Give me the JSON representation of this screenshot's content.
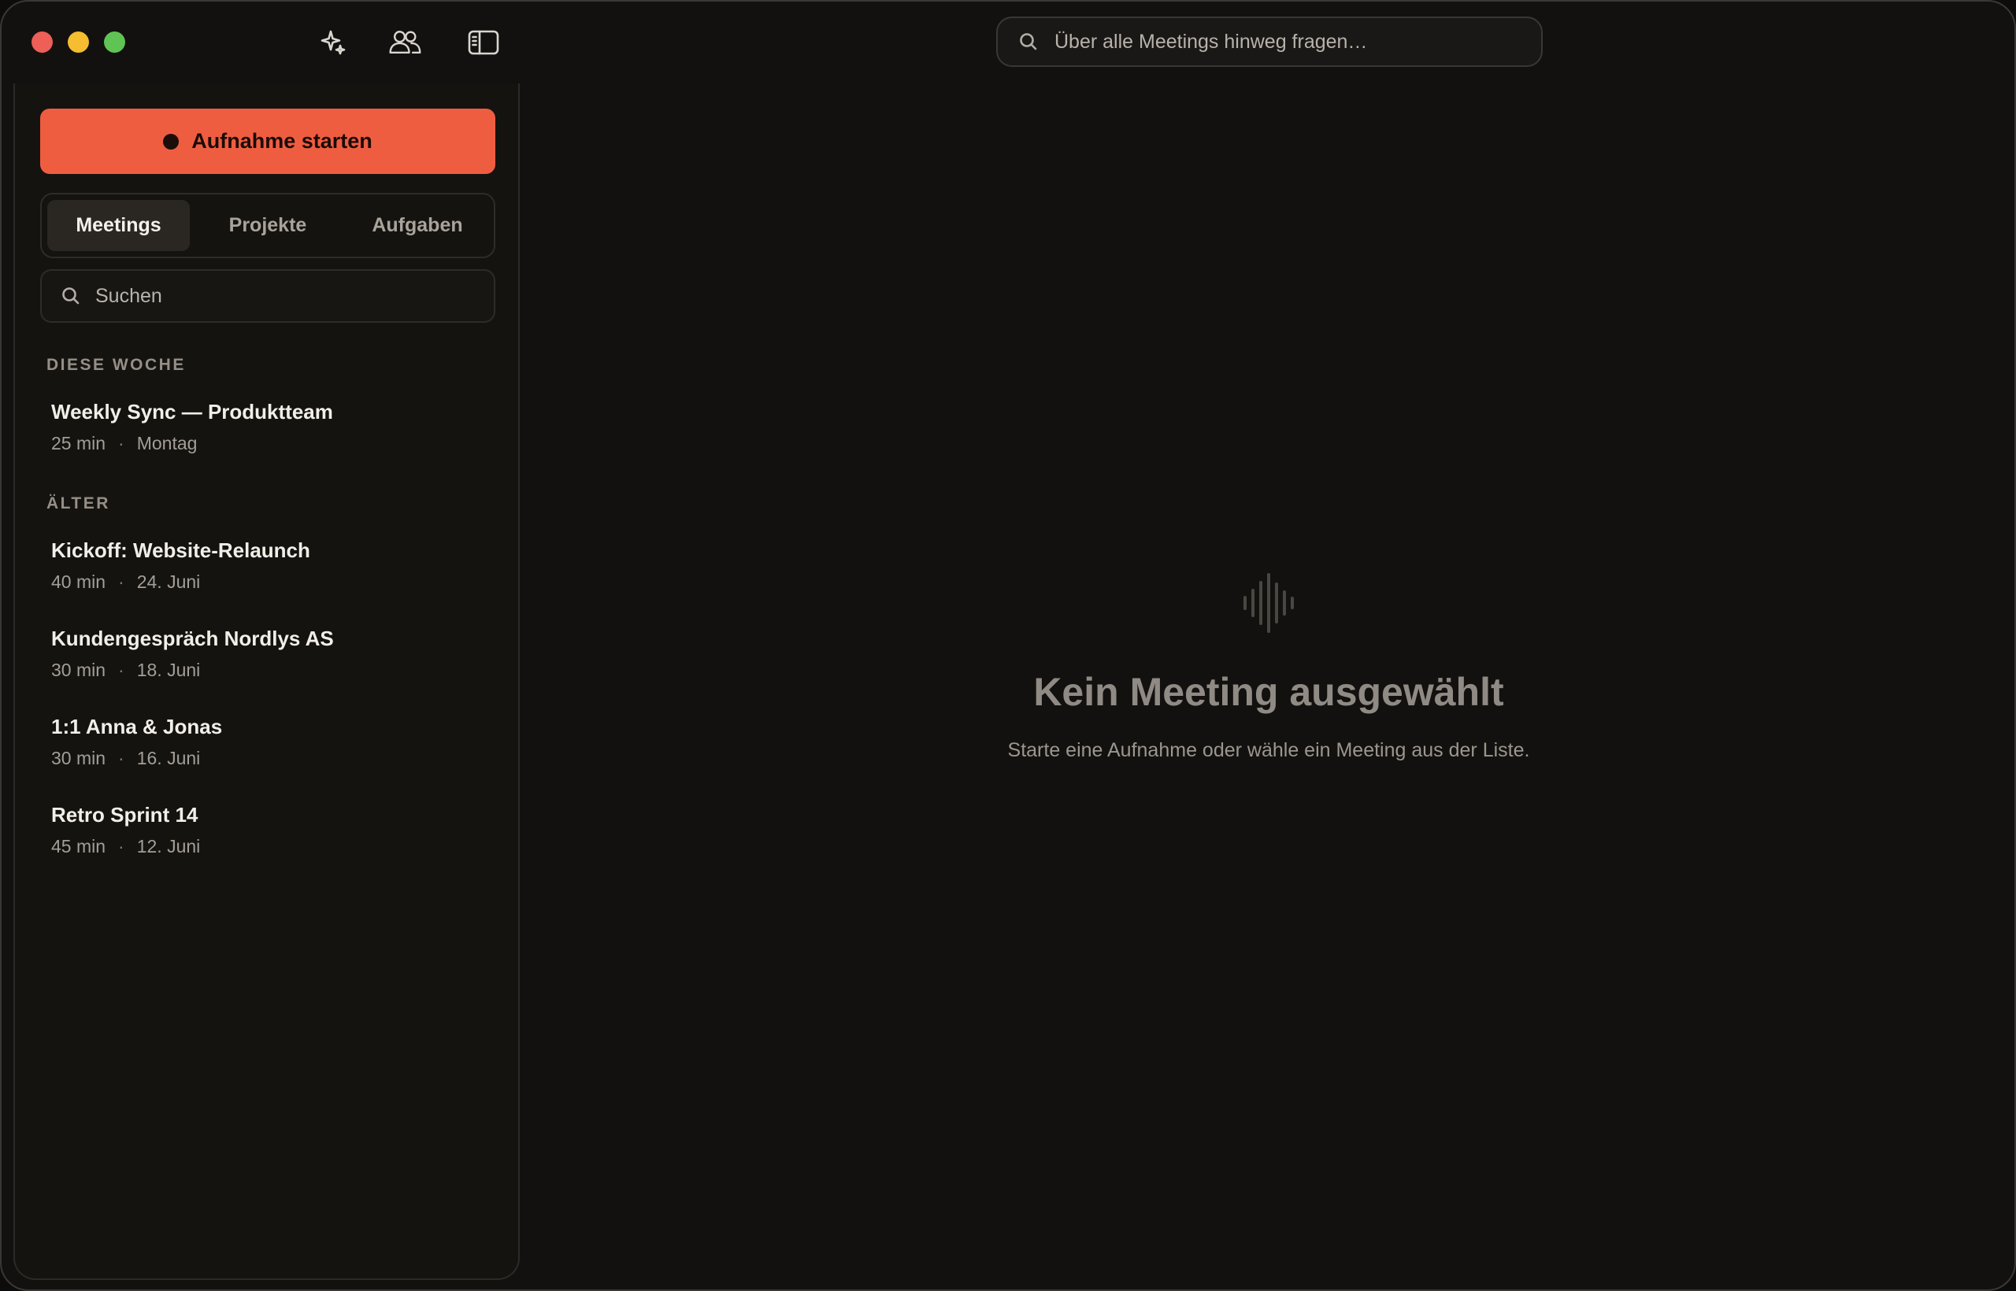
{
  "titlebar": {
    "icons": [
      "sparkles-icon",
      "people-icon",
      "sidebar-toggle-icon"
    ],
    "global_search": {
      "placeholder": "Über alle Meetings hinweg fragen…"
    }
  },
  "sidebar": {
    "record_button": {
      "label": "Aufnahme starten",
      "accent": "#ef5d41"
    },
    "tabs": [
      {
        "label": "Meetings",
        "active": true
      },
      {
        "label": "Projekte",
        "active": false
      },
      {
        "label": "Aufgaben",
        "active": false
      }
    ],
    "search": {
      "placeholder": "Suchen"
    },
    "sections": [
      {
        "label": "DIESE WOCHE",
        "meetings": [
          {
            "title": "Weekly Sync — Produktteam",
            "duration": "25 min",
            "date": "Montag"
          }
        ]
      },
      {
        "label": "ÄLTER",
        "meetings": [
          {
            "title": "Kickoff: Website-Relaunch",
            "duration": "40 min",
            "date": "24. Juni"
          },
          {
            "title": "Kundengespräch Nordlys AS",
            "duration": "30 min",
            "date": "18. Juni"
          },
          {
            "title": "1:1 Anna & Jonas",
            "duration": "30 min",
            "date": "16. Juni"
          },
          {
            "title": "Retro Sprint 14",
            "duration": "45 min",
            "date": "12. Juni"
          }
        ]
      }
    ]
  },
  "main": {
    "empty_state": {
      "icon": "waveform-icon",
      "title": "Kein Meeting ausgewählt",
      "subtitle": "Starte eine Aufnahme oder wähle ein Meeting aus der Liste."
    }
  },
  "colors": {
    "background": "#13110f",
    "sidebar": "#15130f",
    "accent": "#ef5d41",
    "text": "#f2eee8",
    "muted": "#a39e96"
  }
}
